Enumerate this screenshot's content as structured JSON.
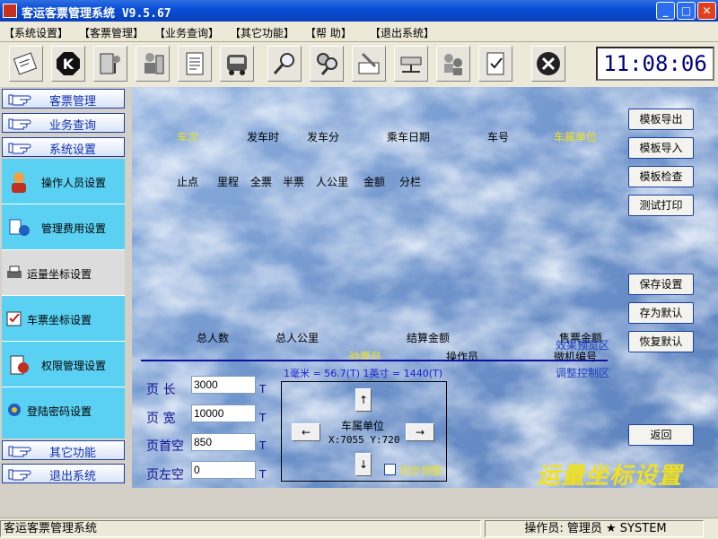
{
  "window": {
    "title": "客运客票管理系统 V9.5.67",
    "min": "_",
    "max": "□",
    "close": "✕"
  },
  "menu": [
    "【系统设置】",
    "【客票管理】",
    "【业务查询】",
    "【其它功能】",
    "【帮    助】",
    "【退出系统】"
  ],
  "toolbar": {
    "icons": [
      "ticket-icon",
      "stop-k-icon",
      "equipment-icon",
      "person-config-icon",
      "document-icon",
      "bus-icon",
      "magnifier-icon",
      "double-magnifier-icon",
      "pen-icon",
      "network-icon",
      "users-icon",
      "checklist-icon",
      "exit-icon"
    ]
  },
  "clock": "11:08:06",
  "sidebar": {
    "heads_top": [
      "客票管理",
      "业务查询",
      "系统设置"
    ],
    "items": [
      {
        "label": "操作人员设置",
        "icon": "operator-icon"
      },
      {
        "label": "管理费用设置",
        "icon": "fee-icon"
      },
      {
        "label": "运量坐标设置",
        "icon": "printer-icon",
        "active": true
      },
      {
        "label": "车票坐标设置",
        "icon": "ticket-coord-icon"
      },
      {
        "label": "权限管理设置",
        "icon": "permission-icon"
      },
      {
        "label": "登陆密码设置",
        "icon": "password-icon"
      }
    ],
    "heads_bottom": [
      "其它功能",
      "退出系统"
    ]
  },
  "canvas": {
    "header_row1": [
      {
        "text": "车次",
        "color": "yellow"
      },
      {
        "text": "发车时",
        "color": "black"
      },
      {
        "text": "发车分",
        "color": "black"
      },
      {
        "text": "乘车日期",
        "color": "black"
      },
      {
        "text": "车号",
        "color": "black"
      },
      {
        "text": "车属单位",
        "color": "yellow"
      }
    ],
    "header_row2": [
      "止点",
      "里程",
      "全票",
      "半票",
      "人公里",
      "金额",
      "分栏"
    ],
    "footer_row1": [
      "总人数",
      "总人公里",
      "结算金额",
      "售票金额"
    ],
    "footer_row2": [
      {
        "text": "验票员",
        "color": "yellow"
      },
      {
        "text": "操作员",
        "color": "black"
      },
      {
        "text": "微机编号",
        "color": "black"
      }
    ],
    "overlay_blue": [
      "效果预览区",
      "调整控制区"
    ]
  },
  "form": {
    "page_length": {
      "label": "页  长",
      "value": "3000",
      "unit": "T"
    },
    "page_width": {
      "label": "页  宽",
      "value": "10000",
      "unit": "T"
    },
    "page_top": {
      "label": "页首空",
      "value": "850",
      "unit": "T"
    },
    "page_left": {
      "label": "页左空",
      "value": "0",
      "unit": "T"
    },
    "scale": "1毫米 = 56.7(T)  1英寸 = 1440(T)"
  },
  "adjust": {
    "up": "↑",
    "down": "↓",
    "left": "←",
    "right": "→",
    "selected": "车属单位",
    "coords": "X:7055  Y:720",
    "sync_label": "同步调整"
  },
  "buttons_right": [
    "模板导出",
    "模板导入",
    "模板检查",
    "测试打印",
    "保存设置",
    "存为默认",
    "恢复默认",
    "返回"
  ],
  "page_title": "运量坐标设置",
  "status": {
    "app": "客运客票管理系统",
    "operator": "操作员: 管理员 ★ SYSTEM"
  }
}
